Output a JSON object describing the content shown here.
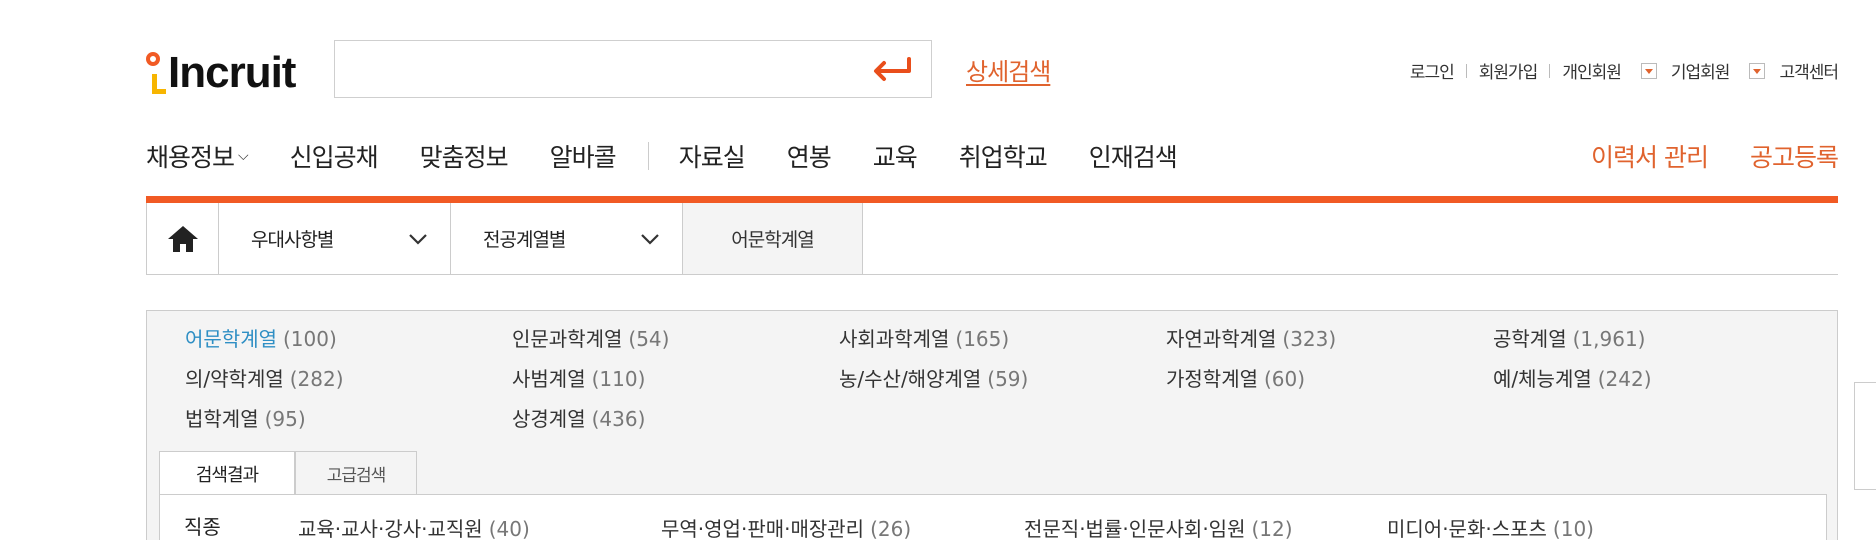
{
  "header": {
    "logo_text": "Incruit",
    "search": {
      "value": "",
      "placeholder": ""
    },
    "detail_search_label": "상세검색",
    "util": {
      "login": "로그인",
      "signup": "회원가입",
      "personal": "개인회원",
      "corporate": "기업회원",
      "customer_center": "고객센터"
    }
  },
  "gnb": {
    "items": [
      "채용정보",
      "신입공채",
      "맞춤정보",
      "알바콜"
    ],
    "items2": [
      "자료실",
      "연봉",
      "교육",
      "취업학교",
      "인재검색"
    ],
    "resume": "이력서 관리",
    "post_job": "공고등록"
  },
  "location": {
    "drop1": "우대사항별",
    "drop2": "전공계열별",
    "current": "어문학계열"
  },
  "categories": [
    {
      "name": "어문학계열",
      "count": "(100)"
    },
    {
      "name": "인문과학계열",
      "count": "(54)"
    },
    {
      "name": "사회과학계열",
      "count": "(165)"
    },
    {
      "name": "자연과학계열",
      "count": "(323)"
    },
    {
      "name": "공학계열",
      "count": "(1,961)"
    },
    {
      "name": "의/약학계열",
      "count": "(282)"
    },
    {
      "name": "사범계열",
      "count": "(110)"
    },
    {
      "name": "농/수산/해양계열",
      "count": "(59)"
    },
    {
      "name": "가정학계열",
      "count": "(60)"
    },
    {
      "name": "예/체능계열",
      "count": "(242)"
    },
    {
      "name": "법학계열",
      "count": "(95)"
    },
    {
      "name": "상경계열",
      "count": "(436)"
    }
  ],
  "tabs": {
    "result": "검색결과",
    "advanced": "고급검색"
  },
  "jobs": {
    "label": "직종",
    "items": [
      {
        "name": "교육·교사·강사·교직원",
        "count": "(40)"
      },
      {
        "name": "무역·영업·판매·매장관리",
        "count": "(26)"
      },
      {
        "name": "전문직·법률·인문사회·임원",
        "count": "(12)"
      },
      {
        "name": "미디어·문화·스포츠",
        "count": "(10)"
      }
    ]
  },
  "colors": {
    "brand": "#f15a24",
    "accent_text": "#e0632e",
    "active_link": "#2f8fc4"
  }
}
